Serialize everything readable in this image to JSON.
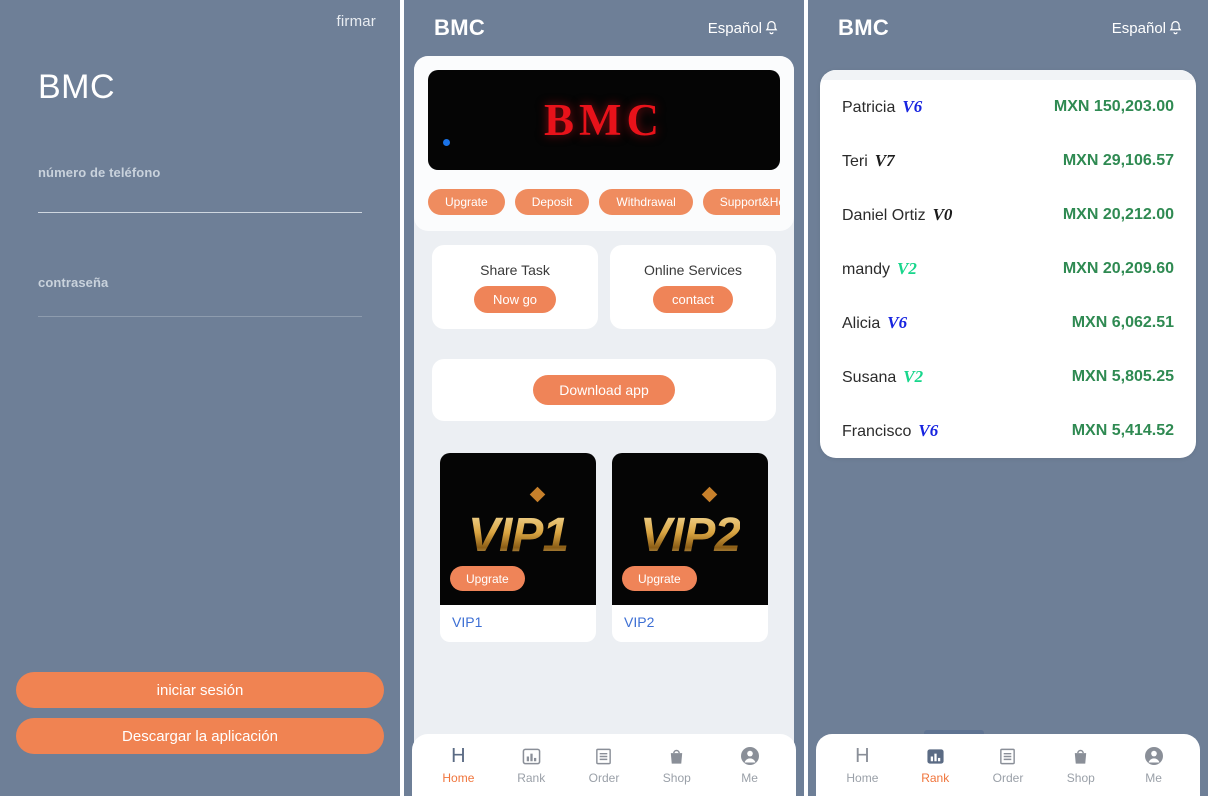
{
  "login": {
    "sign_link": "firmar",
    "brand": "BMC",
    "phone_label": "número de teléfono",
    "phone_value": "",
    "password_label": "contraseña",
    "password_value": "",
    "login_button": "iniciar sesión",
    "download_button": "Descargar la aplicación",
    "bg_color": "#6e7f97",
    "accent_color": "#f08352"
  },
  "home": {
    "header": {
      "brand": "BMC",
      "language": "Español",
      "bell_icon": "bell-icon"
    },
    "banner": {
      "text": "BMC",
      "dot_color": "#1a73e8",
      "bg_color": "#050505",
      "text_color": "#e8121a"
    },
    "quick_actions": [
      {
        "label": "Upgrate"
      },
      {
        "label": "Deposit"
      },
      {
        "label": "Withdrawal"
      },
      {
        "label": "Support&Help"
      }
    ],
    "mini_cards": [
      {
        "title": "Share Task",
        "button": "Now go"
      },
      {
        "title": "Online Services",
        "button": "contact"
      }
    ],
    "download_card": {
      "button": "Download app"
    },
    "vip_cards": [
      {
        "art": "VIP1",
        "button": "Upgrate",
        "label": "VIP1"
      },
      {
        "art": "VIP2",
        "button": "Upgrate",
        "label": "VIP2"
      }
    ],
    "tabs": [
      {
        "label": "Home",
        "icon": "home-icon",
        "active": true
      },
      {
        "label": "Rank",
        "icon": "bar-chart-icon",
        "active": false
      },
      {
        "label": "Order",
        "icon": "receipt-icon",
        "active": false
      },
      {
        "label": "Shop",
        "icon": "shopping-bag-icon",
        "active": false
      },
      {
        "label": "Me",
        "icon": "user-circle-icon",
        "active": false
      }
    ]
  },
  "rank": {
    "header": {
      "brand": "BMC",
      "language": "Español",
      "bell_icon": "bell-icon"
    },
    "currency": "MXN",
    "rows": [
      {
        "name": "Patricia",
        "badge": "V6",
        "badge_color": "#1724e0",
        "amount": "MXN 150,203.00"
      },
      {
        "name": "Teri",
        "badge": "V7",
        "badge_color": "#1c1c1c",
        "amount": "MXN 29,106.57"
      },
      {
        "name": "Daniel Ortiz",
        "badge": "V0",
        "badge_color": "#1c1c1c",
        "amount": "MXN 20,212.00"
      },
      {
        "name": "mandy",
        "badge": "V2",
        "badge_color": "#18d68c",
        "amount": "MXN 20,209.60"
      },
      {
        "name": "Alicia",
        "badge": "V6",
        "badge_color": "#1724e0",
        "amount": "MXN 6,062.51"
      },
      {
        "name": "Susana",
        "badge": "V2",
        "badge_color": "#18d68c",
        "amount": "MXN 5,805.25"
      },
      {
        "name": "Francisco",
        "badge": "V6",
        "badge_color": "#1724e0",
        "amount": "MXN 5,414.52"
      }
    ],
    "amount_color": "#2f8a52",
    "tabs": [
      {
        "label": "Home",
        "icon": "home-icon",
        "active": false
      },
      {
        "label": "Rank",
        "icon": "bar-chart-icon",
        "active": true
      },
      {
        "label": "Order",
        "icon": "receipt-icon",
        "active": false
      },
      {
        "label": "Shop",
        "icon": "shopping-bag-icon",
        "active": false
      },
      {
        "label": "Me",
        "icon": "user-circle-icon",
        "active": false
      }
    ]
  }
}
